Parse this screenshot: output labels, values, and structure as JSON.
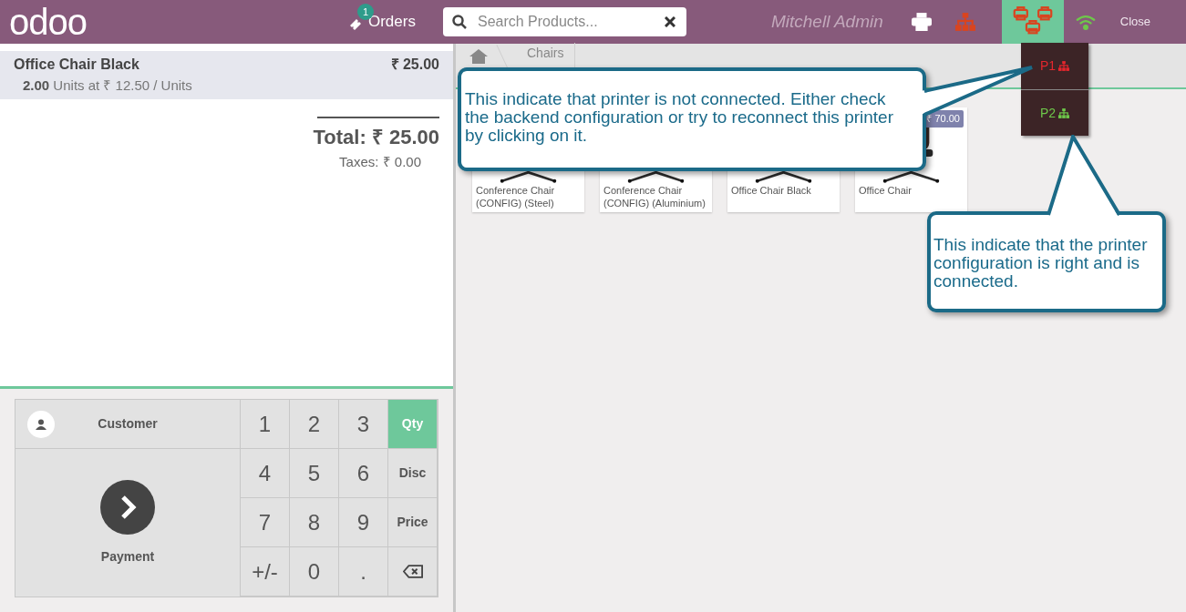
{
  "header": {
    "logo": "odoo",
    "orders": {
      "count": "1",
      "label": "Orders"
    },
    "search": {
      "placeholder": "Search Products..."
    },
    "user": "Mitchell Admin",
    "status_icons": [
      {
        "kind": "printer",
        "color": "#ffffff",
        "selected": false
      },
      {
        "kind": "network",
        "color": "#d9441f",
        "selected": false
      },
      {
        "kind": "printers",
        "color": "#d9441f",
        "selected": true
      },
      {
        "kind": "wifi",
        "color": "#6ec84a",
        "selected": false
      }
    ],
    "close": "Close"
  },
  "order": {
    "lines": [
      {
        "name": "Office Chair Black",
        "detail": "**2.00** Units at ₹ 12.50 / Units",
        "price": "₹ 25.00",
        "selected": true
      }
    ],
    "total": "Total: ₹ 25.00",
    "taxes": "Taxes: ₹ 0.00"
  },
  "numpad": {
    "customer": "Customer",
    "payment": "Payment",
    "keys": [
      {
        "kind": "digit",
        "label": "1"
      },
      {
        "kind": "digit",
        "label": "2"
      },
      {
        "kind": "digit",
        "label": "3"
      },
      {
        "kind": "mode",
        "label": "Qty",
        "selected": true
      },
      {
        "kind": "digit",
        "label": "4"
      },
      {
        "kind": "digit",
        "label": "5"
      },
      {
        "kind": "digit",
        "label": "6"
      },
      {
        "kind": "mode",
        "label": "Disc",
        "selected": false
      },
      {
        "kind": "digit",
        "label": "7"
      },
      {
        "kind": "digit",
        "label": "8"
      },
      {
        "kind": "digit",
        "label": "9"
      },
      {
        "kind": "mode",
        "label": "Price",
        "selected": false
      },
      {
        "kind": "digit",
        "label": "+/-"
      },
      {
        "kind": "digit",
        "label": "0"
      },
      {
        "kind": "digit",
        "label": "."
      },
      {
        "kind": "backspace"
      }
    ]
  },
  "breadcrumb": "Chairs",
  "products": [
    {
      "name": "Conference Chair (CONFIG) (Steel)"
    },
    {
      "name": "Conference Chair (CONFIG) (Aluminium)"
    },
    {
      "name": "Office Chair Black"
    },
    {
      "name": "Office Chair",
      "price": "₹ 70.00"
    }
  ],
  "printers": [
    {
      "label": "P1",
      "connected": false
    },
    {
      "label": "P2",
      "connected": true
    }
  ],
  "callouts": [
    "This indicate that printer is not connected. Either check the backend configuration or try to reconnect this printer by clicking on it.",
    "This indicate that the printer configuration is right and is connected."
  ]
}
